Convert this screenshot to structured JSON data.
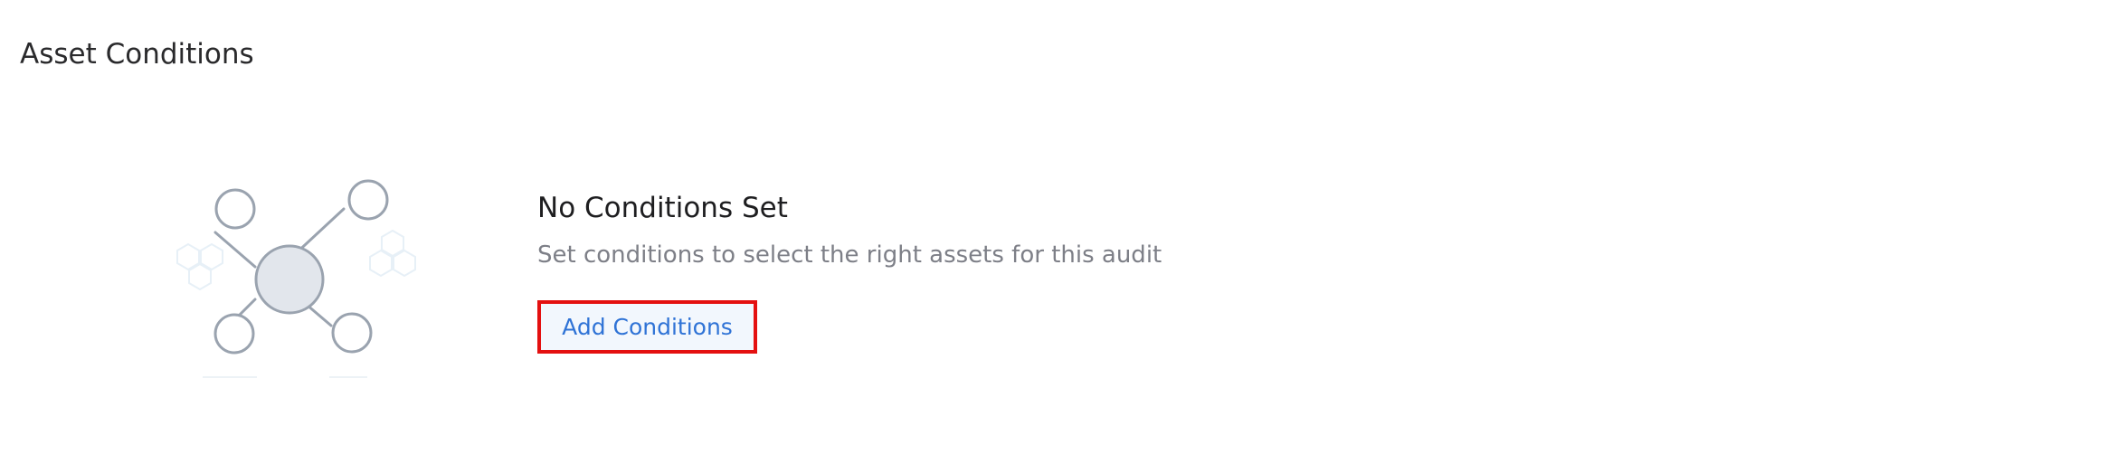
{
  "page": {
    "section_title": "Asset Conditions"
  },
  "empty_state": {
    "illustration_icon": "network-nodes-icon",
    "title": "No Conditions Set",
    "description": "Set conditions to select the right assets for this audit",
    "action_label": "Add Conditions"
  },
  "colors": {
    "action_text": "#2f73d6",
    "action_background": "#f2f7fd",
    "highlight_border": "#e41010",
    "description_text": "#7d7f87"
  }
}
